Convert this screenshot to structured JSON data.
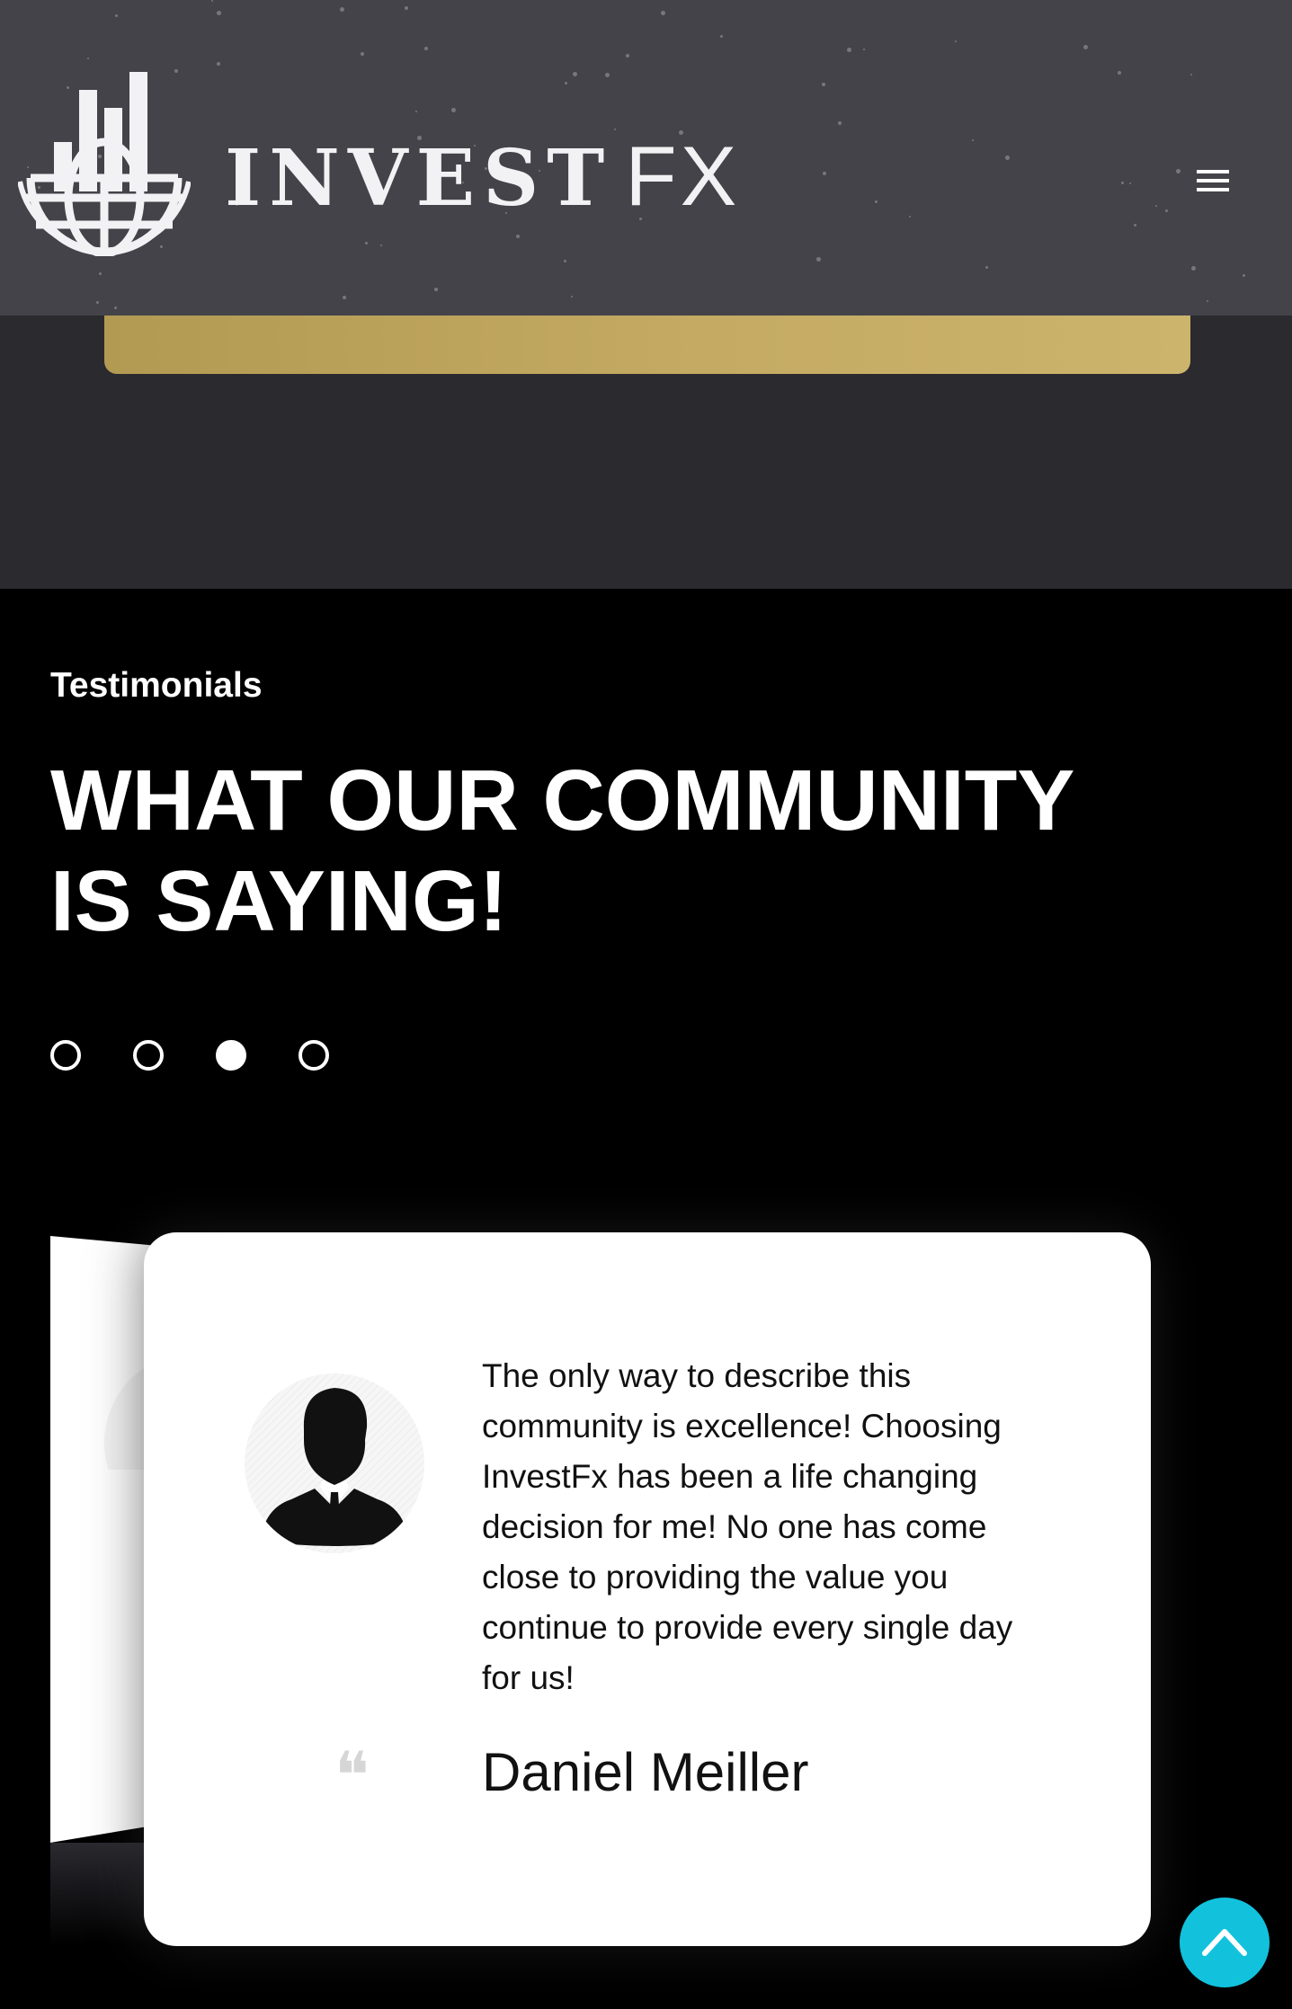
{
  "header": {
    "logo_word": "INVEST",
    "logo_fx": "FX",
    "menu_icon": "hamburger-menu-icon"
  },
  "hero": {
    "cta_color": "#c4aa62"
  },
  "testimonials": {
    "eyebrow": "Testimonials",
    "heading_line1": "WHAT OUR COMMUNITY",
    "heading_line2": "IS SAYING!",
    "carousel": {
      "slide_count": 4,
      "active_index": 2
    },
    "current": {
      "avatar_icon": "user-silhouette-icon",
      "quote_icon": "quote-icon",
      "quote_mark": "❝",
      "text": "The only way to describe this community is excellence! Choosing InvestFx has been a life changing decision for me! No one has come close to providing the value you continue to provide every single day for us!",
      "author": "Daniel Meiller"
    }
  },
  "back_to_top": {
    "icon": "chevron-up-icon",
    "color": "#12c2dd"
  }
}
